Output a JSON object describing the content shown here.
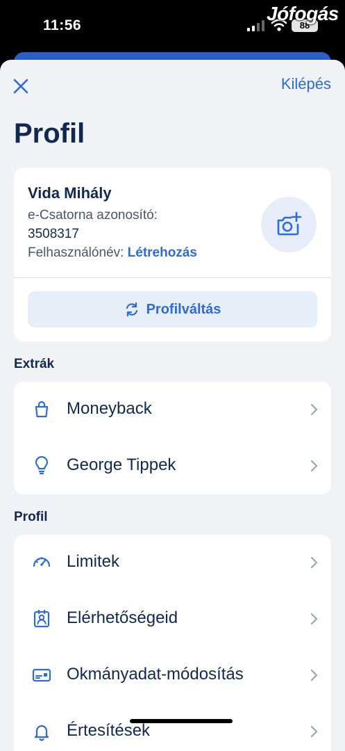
{
  "status": {
    "time": "11:56",
    "battery": "88",
    "watermark": "Jófogás"
  },
  "header": {
    "logout_label": "Kilépés",
    "title": "Profil"
  },
  "profile": {
    "name": "Vida Mihály",
    "ecs_label": "e-Csatorna azonosító:",
    "ecs_id": "3508317",
    "username_label": "Felhasználónév:",
    "username_action": "Létrehozás",
    "switch_label": "Profilváltás"
  },
  "extras": {
    "heading": "Extrák",
    "items": [
      {
        "label": "Moneyback",
        "icon": "shopping-bag-icon"
      },
      {
        "label": "George Tippek",
        "icon": "lightbulb-icon"
      }
    ]
  },
  "profile_section": {
    "heading": "Profil",
    "items": [
      {
        "label": "Limitek",
        "icon": "speedometer-icon"
      },
      {
        "label": "Elérhetőségeid",
        "icon": "contact-card-icon"
      },
      {
        "label": "Okmányadat-módosítás",
        "icon": "id-card-icon"
      },
      {
        "label": "Értesítések",
        "icon": "bell-icon"
      }
    ]
  },
  "colors": {
    "accent": "#2d6bd6",
    "heading": "#12294f",
    "background": "#f0f2f6"
  }
}
